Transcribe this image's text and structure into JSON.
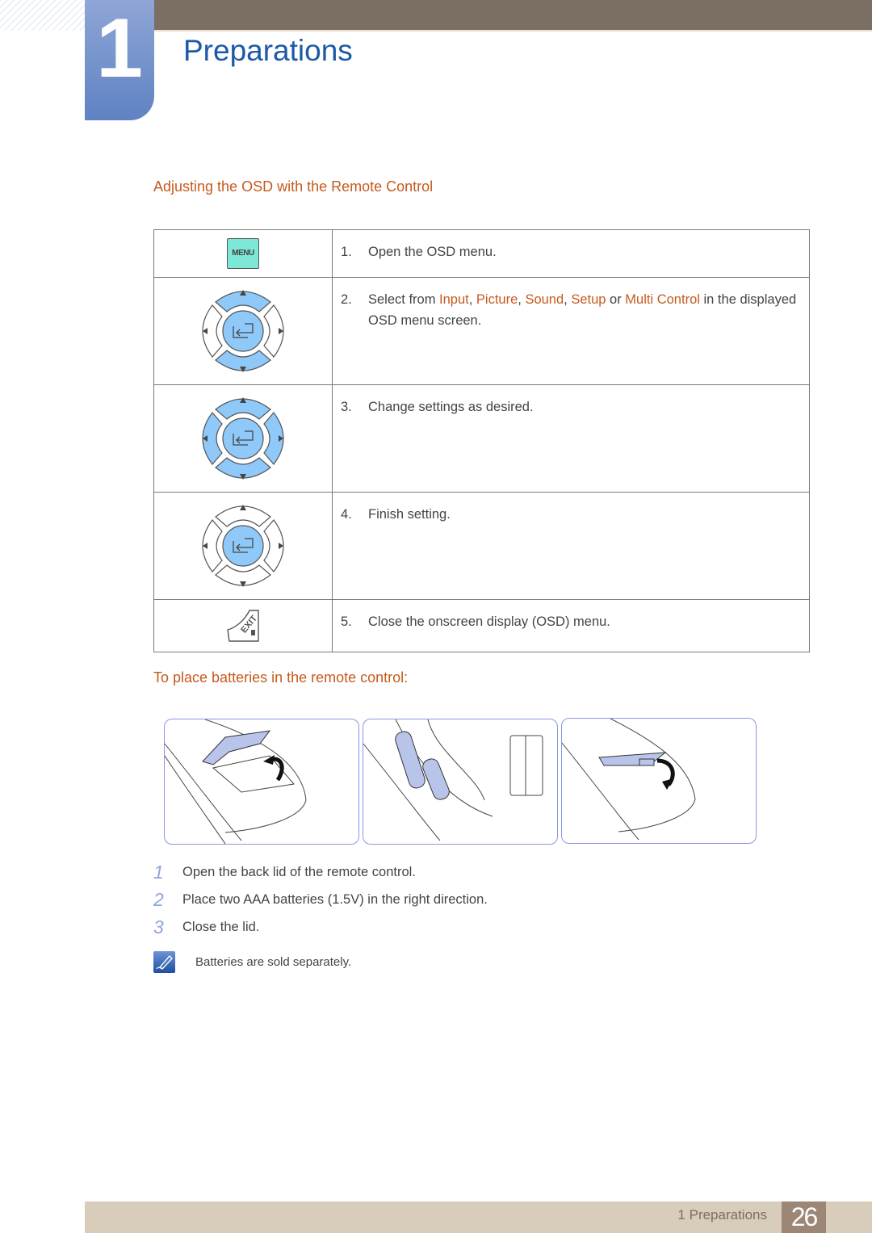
{
  "chapter": {
    "number": "1",
    "title": "Preparations"
  },
  "osd_section": {
    "heading": "Adjusting the OSD with the Remote Control",
    "rows": [
      {
        "icon": "menu-button-icon",
        "button_label": "MENU",
        "num": "1.",
        "text": "Open the OSD menu."
      },
      {
        "icon": "dpad-up-down-icon",
        "num": "2.",
        "text_before": "Select from ",
        "options": [
          "Input",
          "Picture",
          "Sound",
          "Setup",
          "Multi Control"
        ],
        "text_after": " in the displayed OSD menu screen.",
        "sep": ", ",
        "or": " or "
      },
      {
        "icon": "dpad-all-icon",
        "num": "3.",
        "text": "Change settings as desired."
      },
      {
        "icon": "dpad-enter-icon",
        "num": "4.",
        "text": "Finish setting."
      },
      {
        "icon": "exit-button-icon",
        "button_label": "EXIT",
        "num": "5.",
        "text": "Close the onscreen display (OSD) menu."
      }
    ]
  },
  "battery_section": {
    "heading": "To place batteries in the remote control:",
    "images": [
      "open-lid-illustration",
      "insert-batteries-illustration",
      "close-lid-illustration"
    ],
    "steps": [
      {
        "num": "1",
        "text": "Open the back lid of the remote control."
      },
      {
        "num": "2",
        "text": "Place two AAA batteries (1.5V) in the right direction."
      },
      {
        "num": "3",
        "text": "Close the lid."
      }
    ],
    "note": "Batteries are sold separately."
  },
  "footer": {
    "label": "1 Preparations",
    "page": "26"
  },
  "colors": {
    "accent": "#c65a1e",
    "title_blue": "#1d5aa6",
    "button_blue": "#8ec9f9",
    "menu_green": "#7de8d8"
  }
}
